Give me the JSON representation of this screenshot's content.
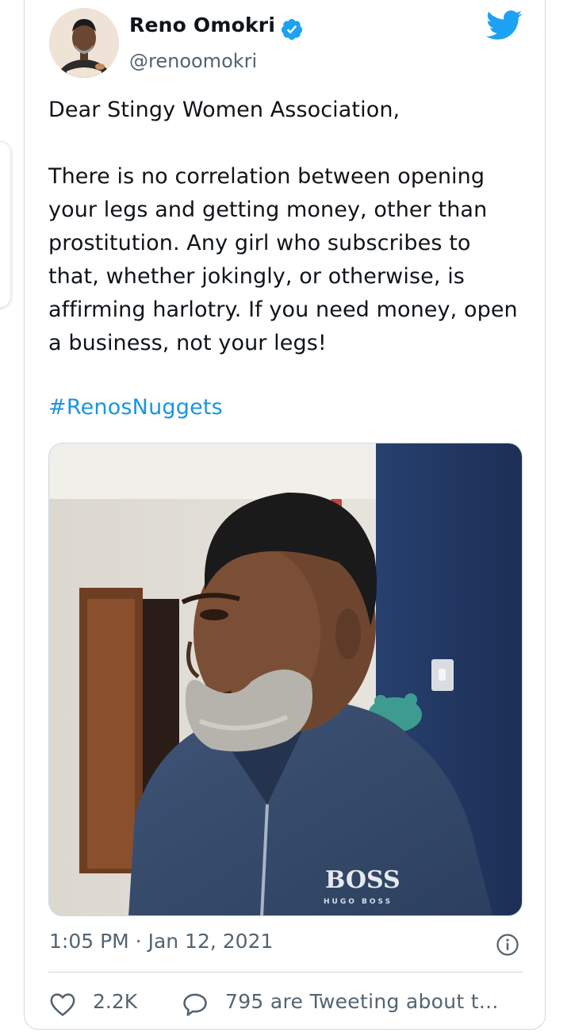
{
  "tweet": {
    "author": {
      "display_name": "Reno Omokri",
      "handle": "@renoomokri",
      "verified": true,
      "avatar_icon": "profile-photo"
    },
    "text": "Dear Stingy Women Association,\n\nThere is no correlation between opening your legs and getting money, other than prostitution. Any girl who subscribes to that, whether jokingly, or otherwise, is affirming harlotry. If you need money, open a business, not your legs!",
    "hashtag": "#RenosNuggets",
    "media": {
      "icon": "photo",
      "jacket_brand": "BOSS",
      "jacket_subbrand": "HUGO BOSS"
    },
    "timestamp": "1:05 PM · Jan 12, 2021",
    "stats": {
      "likes": "2.2K",
      "tweeting": "795 are Tweeting about t..."
    }
  },
  "icons": {
    "brand": "twitter-bird-icon",
    "verified": "verified-badge-icon",
    "info": "info-icon",
    "like": "heart-icon",
    "reply": "reply-icon"
  },
  "colors": {
    "brand_blue": "#1da1f2",
    "hashtag_blue": "#1b95e0",
    "secondary_text": "#536471",
    "border": "#cfd9de"
  }
}
